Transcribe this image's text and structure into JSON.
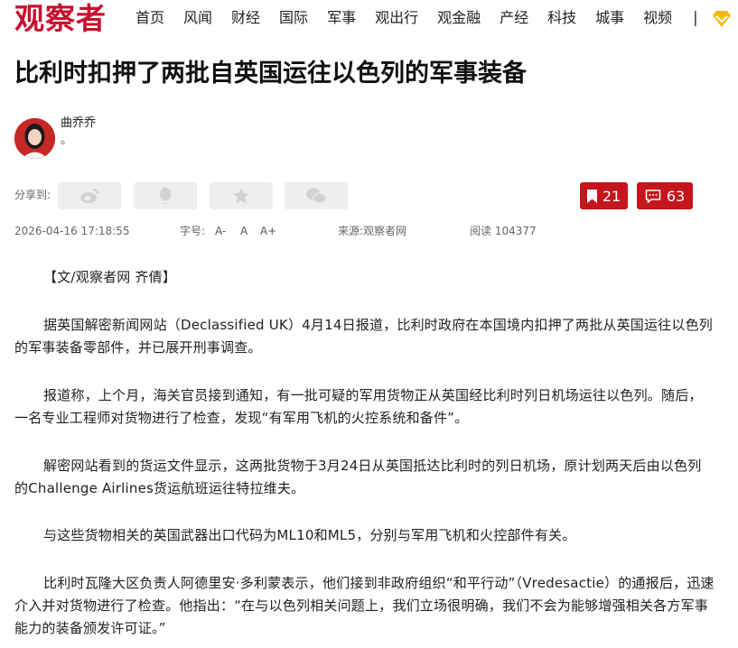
{
  "site": {
    "logo": "观察者"
  },
  "nav": {
    "items": [
      "首页",
      "风闻",
      "财经",
      "国际",
      "军事",
      "观出行",
      "观金融",
      "产经",
      "科技",
      "城事",
      "视频"
    ],
    "separator": "|"
  },
  "article": {
    "title": "比利时扣押了两批自英国运往以色列的军事装备",
    "author": {
      "name": "曲乔乔",
      "desc": "。"
    },
    "share_label": "分享到:",
    "bookmark_count": "21",
    "comment_count": "63",
    "date": "2026-04-16 17:18:55",
    "font_size_label": "字号:",
    "font_small": "A-",
    "font_normal": "A",
    "font_large": "A+",
    "source": "来源:观察者网",
    "reads": "阅读 104377",
    "paragraphs": [
      "【文/观察者网 齐倩】",
      "据英国解密新闻网站（Declassified UK）4月14日报道，比利时政府在本国境内扣押了两批从英国运往以色列的军事装备零部件，并已展开刑事调查。",
      "报道称，上个月，海关官员接到通知，有一批可疑的军用货物正从英国经比利时列日机场运往以色列。随后，一名专业工程师对货物进行了检查，发现“有军用飞机的火控系统和备件”。",
      "解密网站看到的货运文件显示，这两批货物于3月24日从英国抵达比利时的列日机场，原计划两天后由以色列的Challenge Airlines货运航班运往特拉维夫。",
      "与这些货物相关的英国武器出口代码为ML10和ML5，分别与军用飞机和火控部件有关。",
      "比利时瓦隆大区负责人阿德里安·多利蒙表示，他们接到非政府组织“和平行动”（Vredesactie）的通报后，迅速介入并对货物进行了检查。他指出：“在与以色列相关问题上，我们立场很明确，我们不会为能够增强相关各方军事能力的装备颁发许可证。”"
    ]
  },
  "colors": {
    "brand_red": "#c8102e",
    "button_red": "#c4161c",
    "share_bg": "#eeeeee",
    "vip_gold": "#f5b800"
  },
  "icons": [
    "weibo-icon",
    "qq-icon",
    "qzone-star-icon",
    "wechat-icon",
    "bookmark-icon",
    "comment-icon",
    "vip-diamond-icon"
  ]
}
